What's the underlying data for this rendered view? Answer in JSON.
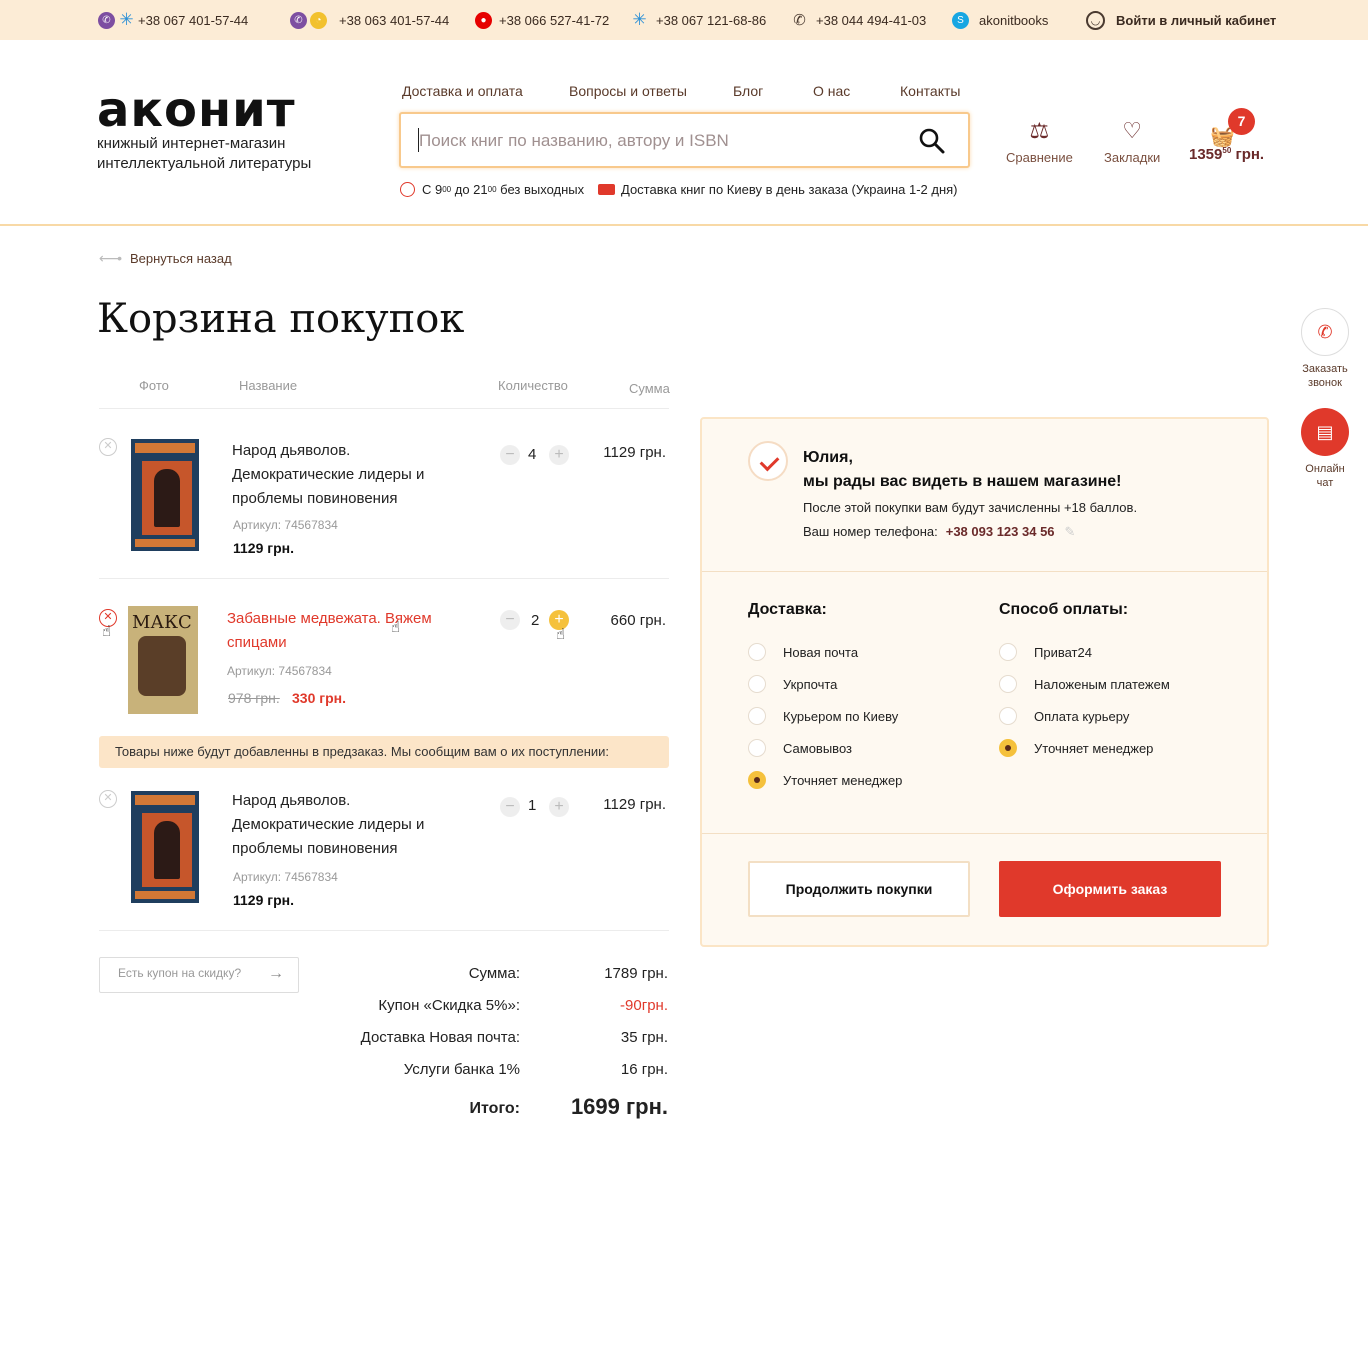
{
  "topbar": {
    "phones": [
      {
        "number": "+38 067 401-57-44",
        "icons": [
          "viber-icon",
          "kyivstar-icon"
        ]
      },
      {
        "number": "+38 063 401-57-44",
        "icons": [
          "viber-icon",
          "lifecell-icon"
        ]
      },
      {
        "number": "+38 066 527-41-72",
        "icons": [
          "vodafone-icon"
        ]
      },
      {
        "number": "+38 067 121-68-86",
        "icons": [
          "kyivstar-icon"
        ]
      },
      {
        "number": "+38 044 494-41-03",
        "icons": [
          "phone-icon"
        ]
      }
    ],
    "skype": "akonitbooks",
    "login": "Войти в личный кабинет"
  },
  "header": {
    "logo": "аконит",
    "tagline": "книжный интернет-магазин интеллектуальной литературы",
    "nav": [
      "Доставка и оплата",
      "Вопросы и ответы",
      "Блог",
      "О нас",
      "Контакты"
    ],
    "search_placeholder": "Поиск книг по названию, автору и ISBN",
    "hours_prefix": "С 9",
    "hours_from_sup": "00",
    "hours_mid": " до 21",
    "hours_to_sup": "00",
    "hours_suffix": " без выходных",
    "delivery_info": "Доставка книг по Киеву в день заказа (Украина 1-2 дня)",
    "compare": "Сравнение",
    "bookmarks": "Закладки",
    "cart_count": "7",
    "cart_price": "1359",
    "cart_price_cents": "50",
    "cart_currency": " грн."
  },
  "back_link": "Вернуться назад",
  "page_title": "Корзина покупок",
  "table_headers": {
    "photo": "Фото",
    "name": "Название",
    "qty": "Количество",
    "sum": "Сумма"
  },
  "items": [
    {
      "title": "Народ дьяволов. Демократические лидеры и проблемы повиновения",
      "sku": "Артикул: 74567834",
      "price": "1129 грн.",
      "qty": "4",
      "sum": "1129 грн."
    },
    {
      "title": "Забавные медвежата. Вяжем спицами",
      "sku": "Артикул: 74567834",
      "old_price": "978 грн.",
      "new_price": "330 грн.",
      "qty": "2",
      "sum": "660 грн."
    },
    {
      "title": "Народ дьяволов. Демократические лидеры и проблемы повиновения",
      "sku": "Артикул: 74567834",
      "price": "1129 грн.",
      "qty": "1",
      "sum": "1129 грн."
    }
  ],
  "preorder_notice": "Товары ниже будут добавленны в предзаказ. Мы сообщим вам о их поступлении:",
  "coupon_placeholder": "Есть купон на скидку?",
  "totals": [
    {
      "label": "Сумма:",
      "value": "1789 грн."
    },
    {
      "label": "Купон «Скидка 5%»:",
      "value": "-90грн."
    },
    {
      "label": "Доставка Новая почта:",
      "value": "35 грн."
    },
    {
      "label": "Услуги банка 1%",
      "value": "16 грн."
    }
  ],
  "grand_total": {
    "label": "Итого:",
    "value": "1699 грн."
  },
  "panel": {
    "name": "Юлия,",
    "message": "мы рады вас видеть в нашем магазине!",
    "bonus": "После этой покупки вам будут зачисленны +18 баллов.",
    "phone_label": "Ваш номер телефона:",
    "phone": "+38 093 123 34 56",
    "delivery_title": "Доставка:",
    "delivery_options": [
      "Новая почта",
      "Укрпочта",
      "Курьером по Киеву",
      "Самовывоз",
      "Уточняет менеджер"
    ],
    "delivery_selected": "Уточняет менеджер",
    "payment_title": "Способ оплаты:",
    "payment_options": [
      "Приват24",
      "Наложеным платежем",
      "Оплата курьеру",
      "Уточняет менеджер"
    ],
    "payment_selected": "Уточняет менеджер",
    "continue": "Продолжить покупки",
    "order": "Оформить заказ"
  },
  "side": {
    "call_line1": "Заказать",
    "call_line2": "звонок",
    "chat_line1": "Онлайн",
    "chat_line2": "чат"
  },
  "colors": {
    "accent": "#e0392b",
    "topbar_bg": "#fcecd6",
    "highlight": "#f5c13c"
  }
}
